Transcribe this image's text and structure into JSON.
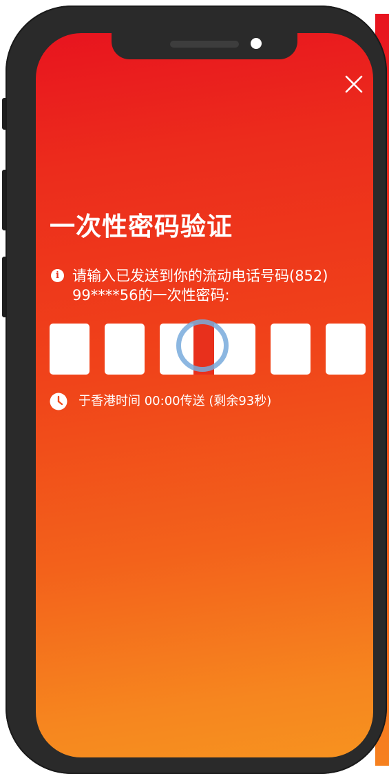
{
  "header": {
    "close_icon": "close-icon"
  },
  "title": "一次性密码验证",
  "info": {
    "icon": "info-icon",
    "icon_glyph": "i",
    "line1": "请输入已发送到你的流动电话号码(852)",
    "line2": "99****56的一次性密码:"
  },
  "otp": {
    "length": 6,
    "values": [
      "",
      "",
      "",
      "",
      "",
      ""
    ],
    "active_index": 2
  },
  "sent": {
    "icon": "clock-icon",
    "text": "于香港时间 00:00传送 (剩余93秒)"
  },
  "colors": {
    "gradient_top": "#e8141f",
    "gradient_bottom": "#f7921f",
    "phone_frame": "#2a2a2a",
    "otp_box": "#ffffff",
    "tap_ring": "#78aadc"
  }
}
